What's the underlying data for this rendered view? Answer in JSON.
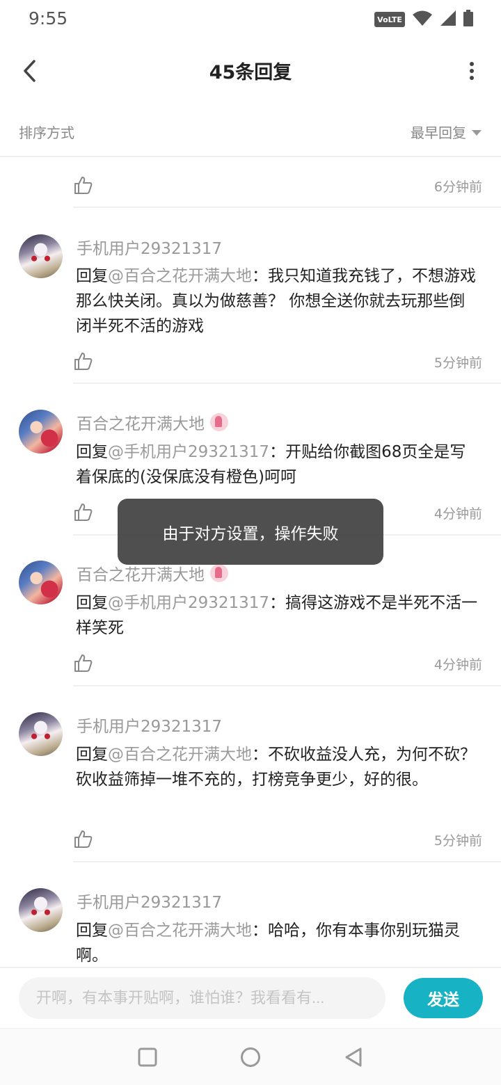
{
  "status": {
    "time": "9:55",
    "volte_label": "VoLTE"
  },
  "header": {
    "title": "45条回复"
  },
  "sort": {
    "label": "排序方式",
    "selected": "最早回复"
  },
  "replies": [
    {
      "time": "6分钟前"
    },
    {
      "user": "手机用户29321317",
      "prefix": "回复",
      "mention": "@百合之花开满大地",
      "body": "：我只知道我充钱了，不想游戏那么快关闭。真以为做慈善？ 你想全送你就去玩那些倒闭半死不活的游戏",
      "time": "5分钟前"
    },
    {
      "user": "百合之花开满大地",
      "prefix": "回复",
      "mention": "@手机用户29321317",
      "body": "：开贴给你截图68页全是写着保底的(没保底没有橙色)呵呵",
      "time": "4分钟前"
    },
    {
      "user": "百合之花开满大地",
      "prefix": "回复",
      "mention": "@手机用户29321317",
      "body": "：搞得这游戏不是半死不活一样笑死",
      "time": "4分钟前"
    },
    {
      "user": "手机用户29321317",
      "prefix": "回复",
      "mention": "@百合之花开满大地",
      "body": "：不砍收益没人充，为何不砍？砍收益筛掉一堆不充的，打榜竞争更少，好的很。",
      "time": "5分钟前"
    },
    {
      "user": "手机用户29321317",
      "prefix": "回复",
      "mention": "@百合之花开满大地",
      "body": "：哈哈，你有本事你别玩猫灵啊。"
    }
  ],
  "toast": {
    "message": "由于对方设置，操作失败"
  },
  "composer": {
    "placeholder": "开啊，有本事开贴啊，谁怕谁？我看看有...",
    "send_label": "发送"
  },
  "colors": {
    "accent": "#17b3c4",
    "toast_bg": "#404040"
  }
}
